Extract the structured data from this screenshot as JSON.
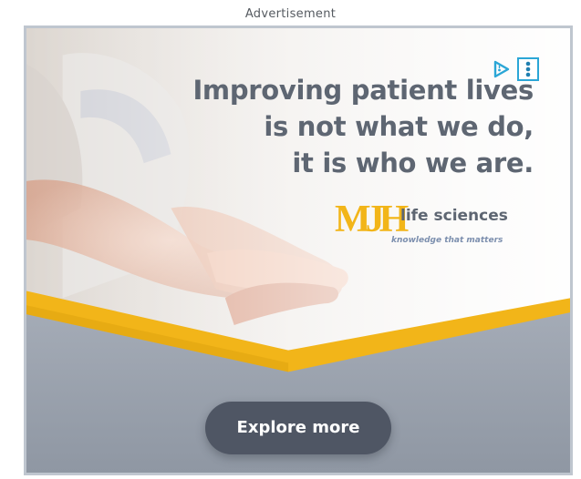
{
  "ad_label": "Advertisement",
  "headline": {
    "line1": "Improving patient lives",
    "line2": "is not what we do,",
    "line3": "it is who we are."
  },
  "brand": {
    "logo_text": "MJH",
    "name": "life sciences",
    "tagline": "knowledge that matters"
  },
  "cta": {
    "label": "Explore more"
  },
  "icons": {
    "adchoices": "adchoices-play-icon",
    "menu": "more-vertical-icon"
  },
  "colors": {
    "accent_yellow": "#f2b519",
    "text_gray": "#5e6672",
    "button_dark": "#4f5664",
    "frame_border": "#bfc6cf",
    "adchoices_blue": "#2ba6d6"
  }
}
